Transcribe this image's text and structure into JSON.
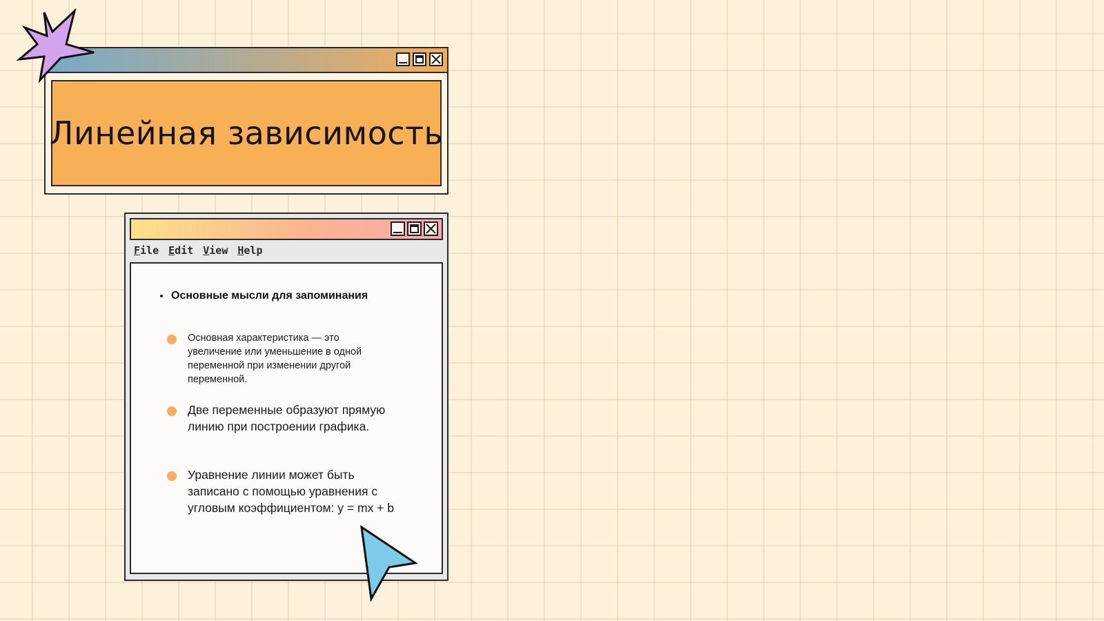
{
  "title_window": {
    "title": "Линейная зависимость"
  },
  "notes_window": {
    "menu": [
      {
        "key": "F",
        "rest": "ile"
      },
      {
        "key": "E",
        "rest": "dit"
      },
      {
        "key": "V",
        "rest": "iew"
      },
      {
        "key": "H",
        "rest": "elp"
      }
    ],
    "heading": "Основные мысли для запоминания",
    "bullets": [
      "Основная характеристика — это увеличение или уменьшение в одной переменной при изменении другой переменной.",
      "Две переменные образуют прямую линию при построении графика.",
      "Уравнение линии может быть записано с помощью уравнения с угловым коэффициентом: y = mx + b"
    ]
  },
  "colors": {
    "background": "#fdf1dc",
    "title_panel": "#f8b057",
    "bullet": "#f6ae5c",
    "star": "#d3a4ee",
    "cursor": "#7ccbe9"
  },
  "icons": [
    "starburst-icon",
    "cursor-arrow-icon",
    "minimize-icon",
    "maximize-icon",
    "close-icon"
  ]
}
